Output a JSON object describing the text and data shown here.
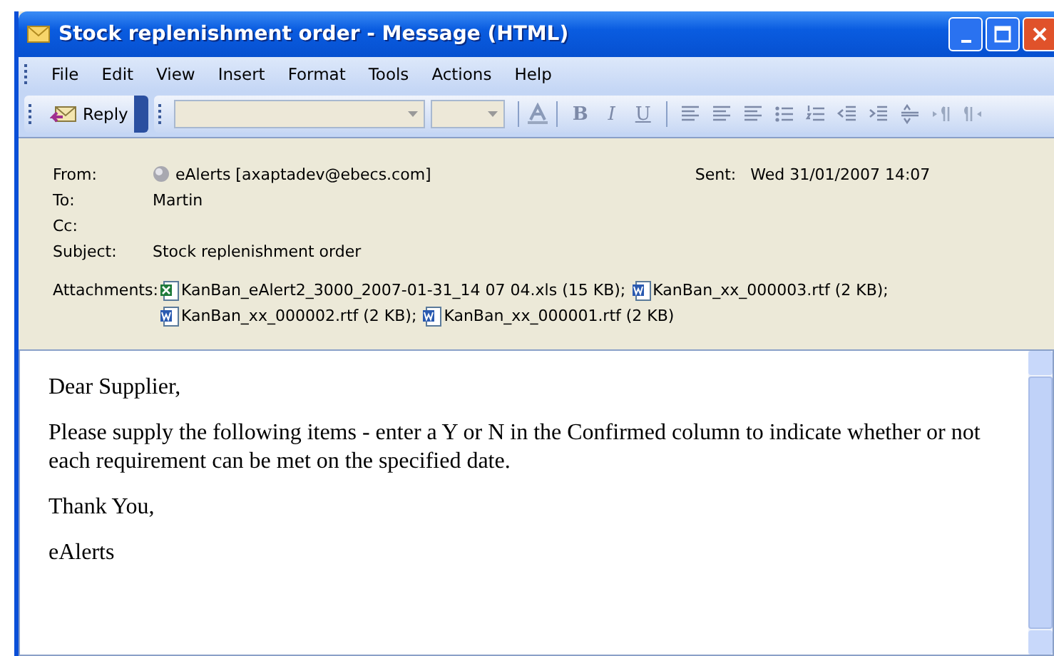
{
  "window": {
    "title": "Stock replenishment order - Message (HTML)"
  },
  "menu": [
    "File",
    "Edit",
    "View",
    "Insert",
    "Format",
    "Tools",
    "Actions",
    "Help"
  ],
  "toolbar": {
    "reply": "Reply",
    "format_buttons": [
      {
        "label": "B",
        "kind": "bold"
      },
      {
        "label": "I",
        "kind": "italic"
      },
      {
        "label": "U",
        "kind": "underline"
      }
    ]
  },
  "header": {
    "from_label": "From:",
    "from": "eAlerts [axaptadev@ebecs.com]",
    "sent_label": "Sent:",
    "sent": "Wed 31/01/2007 14:07",
    "to_label": "To:",
    "to": "Martin",
    "cc_label": "Cc:",
    "subject_label": "Subject:",
    "subject": "Stock replenishment order",
    "attachments_label": "Attachments:",
    "attachments": [
      {
        "kind": "xls",
        "name": "KanBan_eAlert2_3000_2007-01-31_14 07 04.xls (15 KB);"
      },
      {
        "kind": "rtf",
        "name": "KanBan_xx_000003.rtf (2 KB);"
      },
      {
        "kind": "rtf",
        "name": "KanBan_xx_000002.rtf (2 KB);"
      },
      {
        "kind": "rtf",
        "name": "KanBan_xx_000001.rtf (2 KB)"
      }
    ]
  },
  "body": [
    "Dear Supplier,",
    "Please supply the following items - enter a Y or N in the Confirmed column to indicate whether or not each requirement can be met on the specified date.",
    "Thank You,",
    "eAlerts"
  ]
}
